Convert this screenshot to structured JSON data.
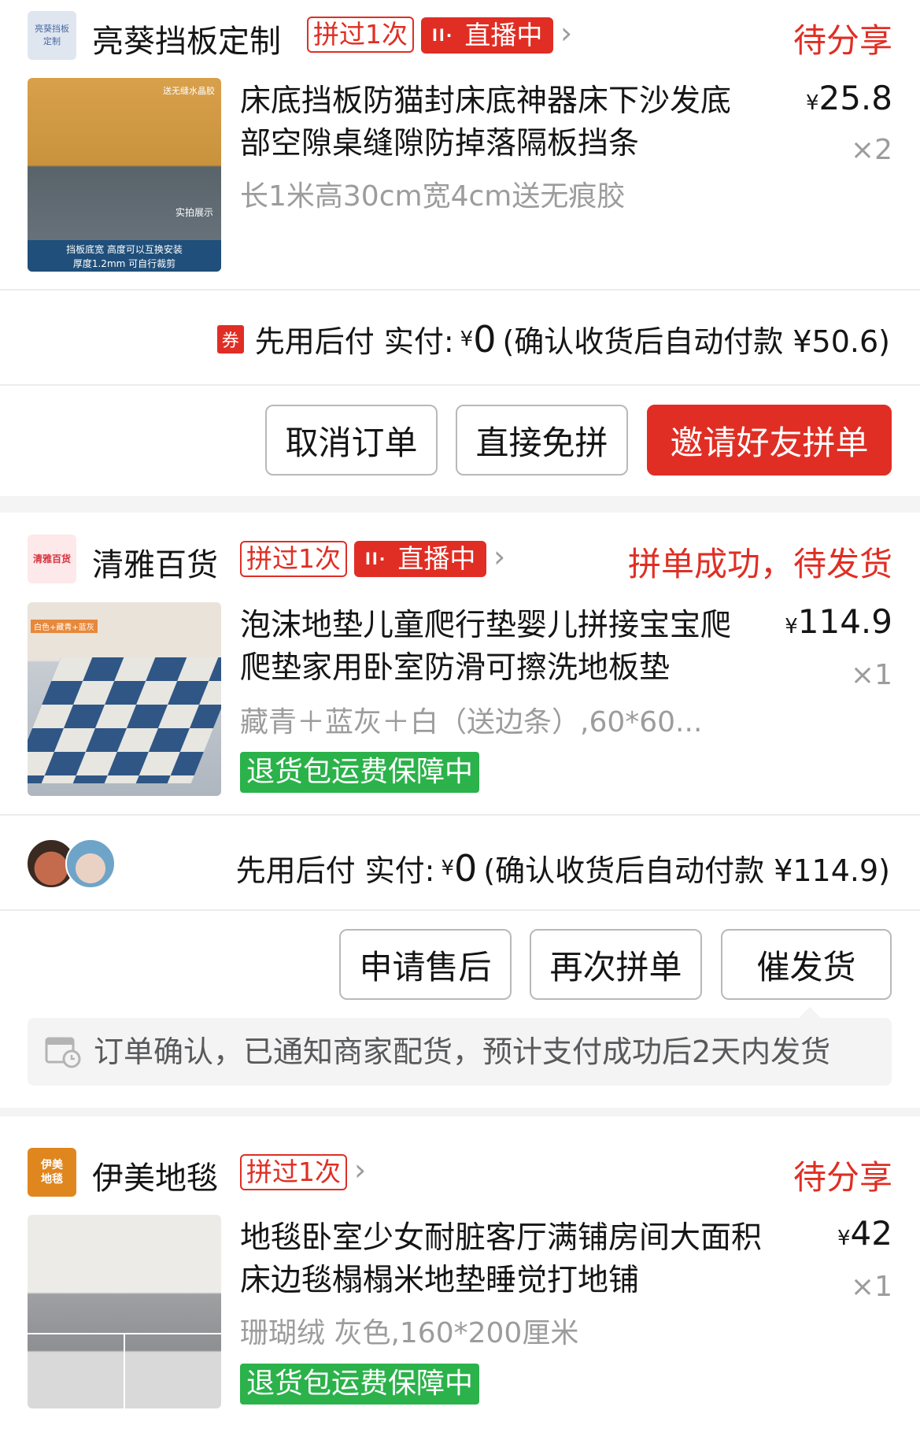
{
  "orders": [
    {
      "shop_name": "亮葵挡板定制",
      "shop_logo_text": "亮葵挡板定制",
      "group_tag": "拼过1次",
      "live_tag": "直播中",
      "status": "待分享",
      "product_title": "床底挡板防猫封床底神器床下沙发底部空隙桌缝隙防掉落隔板挡条",
      "spec": "长1米高30cm宽4cm送无痕胶",
      "price_symbol": "¥",
      "price": "25.8",
      "qty": "×2",
      "thumb_text": [
        "送无缝水晶胶",
        "实拍展示",
        "挡板底宽 高度可以互换安装",
        "厚度1.2mm  可自行裁剪"
      ],
      "coupon_icon": "券",
      "pay_label": "先用后付 实付:",
      "pay_amount": "0",
      "pay_note": "(确认收货后自动付款 ¥50.6)",
      "buttons": [
        "取消订单",
        "直接免拼",
        "邀请好友拼单"
      ]
    },
    {
      "shop_name": "清雅百货",
      "shop_logo_text": "清雅百货",
      "group_tag": "拼过1次",
      "live_tag": "直播中",
      "status": "拼单成功，待发货",
      "product_title": "泡沫地垫儿童爬行垫婴儿拼接宝宝爬爬垫家用卧室防滑可擦洗地板垫",
      "spec": "藏青＋蓝灰＋白（送边条）,60*60...",
      "guarantee": "退货包运费保障中",
      "price_symbol": "¥",
      "price": "114.9",
      "qty": "×1",
      "thumb_text": [
        "白色+藏青+蓝灰"
      ],
      "pay_label": "先用后付 实付:",
      "pay_amount": "0",
      "pay_note": "(确认收货后自动付款 ¥114.9)",
      "buttons": [
        "申请售后",
        "再次拼单",
        "催发货"
      ],
      "notice": "订单确认，已通知商家配货，预计支付成功后2天内发货"
    },
    {
      "shop_name": "伊美地毯",
      "shop_logo_text": "伊美地毯",
      "group_tag": "拼过1次",
      "status": "待分享",
      "product_title": "地毯卧室少女耐脏客厅满铺房间大面积床边毯榻榻米地垫睡觉打地铺",
      "spec": "珊瑚绒 灰色,160*200厘米",
      "guarantee": "退货包运费保障中",
      "price_symbol": "¥",
      "price": "42",
      "qty": "×1"
    }
  ],
  "icons": {
    "chevron": "chevron-right-icon",
    "live": "live-broadcast-icon",
    "coupon": "coupon-icon",
    "calendar": "calendar-clock-icon"
  },
  "colors": {
    "accent": "#e02e24",
    "green": "#2bb24a",
    "muted": "#9c9c9c"
  }
}
